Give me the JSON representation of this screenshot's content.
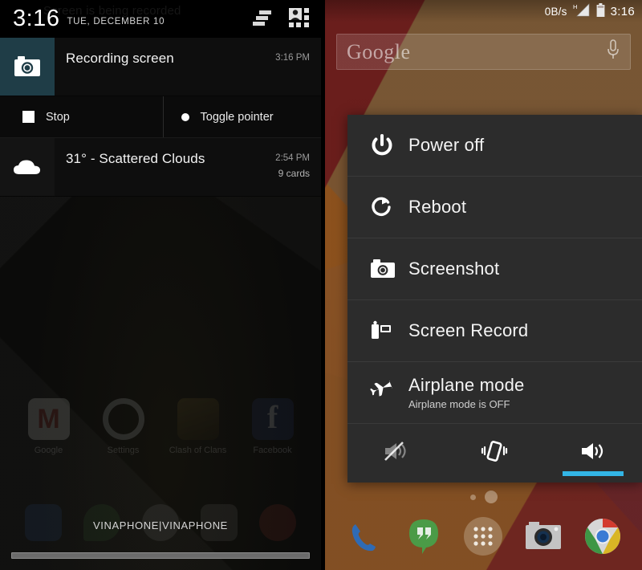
{
  "left_panel": {
    "status_bar": {
      "clock": "3:16",
      "date": "TUE, DECEMBER 10",
      "ghost_text": "Screen is being recorded",
      "icons": [
        "clear-all-icon",
        "multi-user-icon"
      ]
    },
    "notifications": [
      {
        "icon": "camera-icon",
        "title": "Recording screen",
        "time": "3:16 PM",
        "subtext": "",
        "actions": [
          {
            "icon": "stop-square-icon",
            "label": "Stop"
          },
          {
            "icon": "pointer-dot-icon",
            "label": "Toggle pointer"
          }
        ]
      },
      {
        "icon": "cloud-icon",
        "title": "31° - Scattered Clouds",
        "time": "2:54 PM",
        "subtext": "9 cards",
        "actions": []
      }
    ],
    "ghost_apps": [
      {
        "name": "Google",
        "icon": "gmail-icon"
      },
      {
        "name": "Settings",
        "icon": "gear-icon"
      },
      {
        "name": "Clash of Clans",
        "icon": "clash-of-clans-icon"
      },
      {
        "name": "Facebook",
        "icon": "facebook-icon"
      }
    ],
    "carrier": "VINAPHONE|VINAPHONE",
    "drag_handle": "shade-drag-handle"
  },
  "right_panel": {
    "status_bar": {
      "network_speed": "0B/s",
      "signal": "H",
      "battery": "battery-icon",
      "clock": "3:16"
    },
    "search": {
      "logo": "Google",
      "placeholder": "Google",
      "mic": "microphone-icon"
    },
    "power_menu": {
      "items": [
        {
          "icon": "power-icon",
          "label": "Power off",
          "sub": ""
        },
        {
          "icon": "reboot-icon",
          "label": "Reboot",
          "sub": ""
        },
        {
          "icon": "camera-icon",
          "label": "Screenshot",
          "sub": ""
        },
        {
          "icon": "camcorder-icon",
          "label": "Screen Record",
          "sub": ""
        },
        {
          "icon": "airplane-icon",
          "label": "Airplane mode",
          "sub": "Airplane mode is OFF"
        }
      ],
      "sound_modes": [
        {
          "icon": "mute-icon",
          "name": "silent",
          "selected": false
        },
        {
          "icon": "vibrate-icon",
          "name": "vibrate",
          "selected": false
        },
        {
          "icon": "volume-icon",
          "name": "sound",
          "selected": true
        }
      ],
      "accent_color": "#33b5e5"
    },
    "home": {
      "page_dots": 2,
      "active_dot": 2,
      "dock": [
        {
          "icon": "phone-icon",
          "name": "Phone"
        },
        {
          "icon": "hangouts-icon",
          "name": "Hangouts"
        },
        {
          "icon": "app-drawer-icon",
          "name": "Apps"
        },
        {
          "icon": "camera-app-icon",
          "name": "Camera"
        },
        {
          "icon": "chrome-icon",
          "name": "Chrome"
        }
      ]
    }
  }
}
